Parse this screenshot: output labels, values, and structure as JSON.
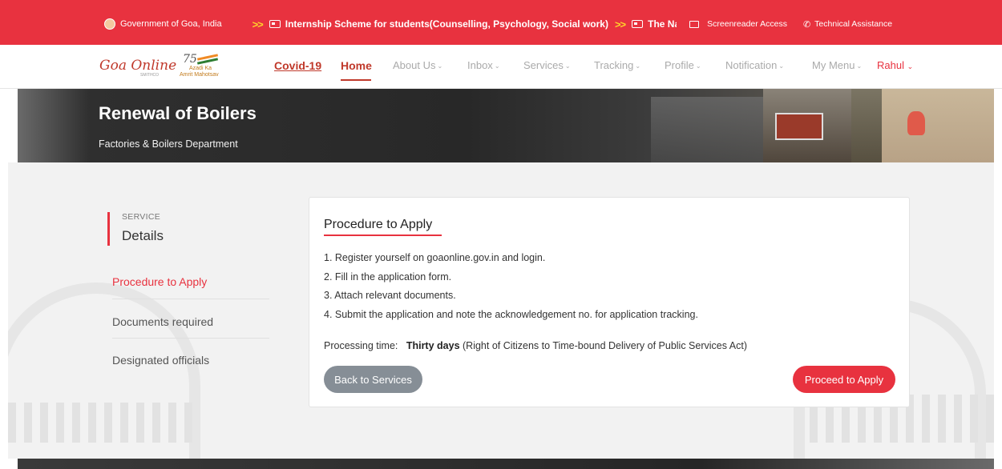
{
  "topbar": {
    "gov_label": "Government of Goa, India",
    "chevrons": ">>",
    "ticker_text": "Internship Scheme for students(Counselling, Psychology, Social work)",
    "ticker_next": "The Na",
    "screenreader": "Screenreader Access",
    "technical": "Technical Assistance"
  },
  "nav": {
    "logo": "Goa Online",
    "logo_sub": "SMITHCO",
    "azadi": {
      "n75": "75",
      "line1": "Azadi Ka",
      "line2": "Amrit Mahotsav"
    },
    "covid": "Covid-19",
    "home": "Home",
    "items": [
      "About Us",
      "Inbox",
      "Services",
      "Tracking",
      "Profile",
      "Notification",
      "My Menu"
    ],
    "user": "Rahul"
  },
  "banner": {
    "title": "Renewal of Boilers",
    "subtitle": "Factories & Boilers Department"
  },
  "sidebar": {
    "service_label": "SERVICE",
    "details_label": "Details",
    "items": [
      "Procedure to Apply",
      "Documents required",
      "Designated officials"
    ],
    "active_index": 0
  },
  "card": {
    "title": "Procedure to Apply",
    "steps": [
      "1. Register yourself on goaonline.gov.in and login.",
      "2. Fill in the application form.",
      "3. Attach relevant documents.",
      "4. Submit the application and note the acknowledgement no. for application tracking."
    ],
    "processing_label": "Processing time:",
    "processing_value": "Thirty days",
    "processing_note": "(Right of Citizens to Time-bound Delivery of Public Services Act)",
    "back_button": "Back to Services",
    "apply_button": "Proceed to Apply"
  },
  "colors": {
    "brand_red": "#e8323f",
    "nav_muted": "#aaaaaa",
    "button_grey": "#868e96"
  }
}
